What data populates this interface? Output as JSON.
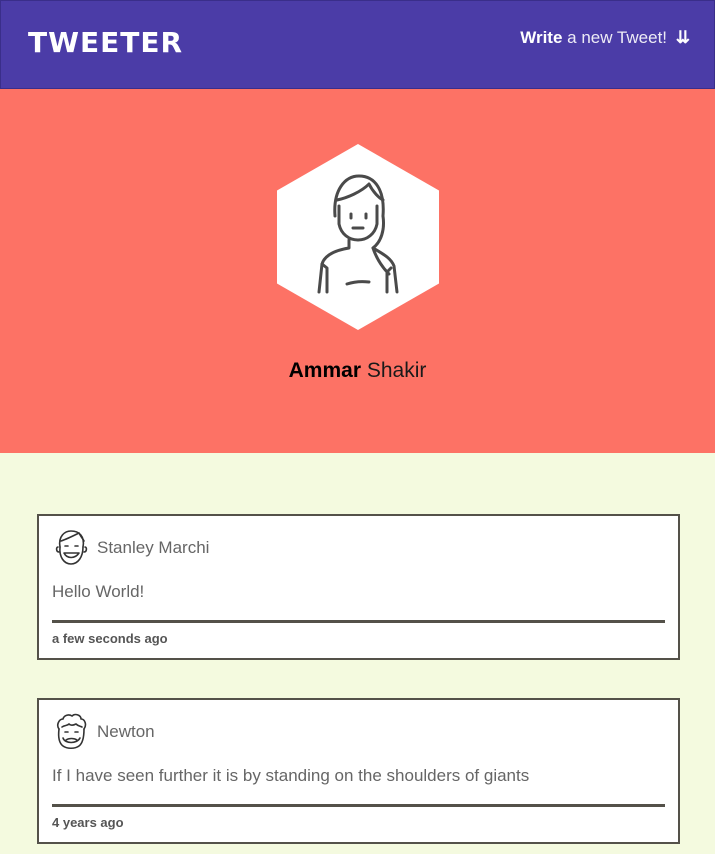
{
  "header": {
    "logo": "TWEETER",
    "compose_bold": "Write",
    "compose_rest": "a new Tweet!",
    "compose_arrows": "⇊"
  },
  "profile": {
    "first_name": "Ammar",
    "last_name": "Shakir"
  },
  "tweets": [
    {
      "author": "Stanley Marchi",
      "text": "Hello World!",
      "time": "a few seconds ago",
      "avatar_icon": "smiling-man-avatar-icon"
    },
    {
      "author": "Newton",
      "text": "If I have seen further it is by standing on the shoulders of giants",
      "time": "4 years ago",
      "avatar_icon": "curly-hair-man-avatar-icon"
    }
  ],
  "colors": {
    "nav_bg": "#4b3ca7",
    "hero_bg": "#fd7265",
    "feed_bg": "#f4fadf",
    "border": "#545149"
  }
}
